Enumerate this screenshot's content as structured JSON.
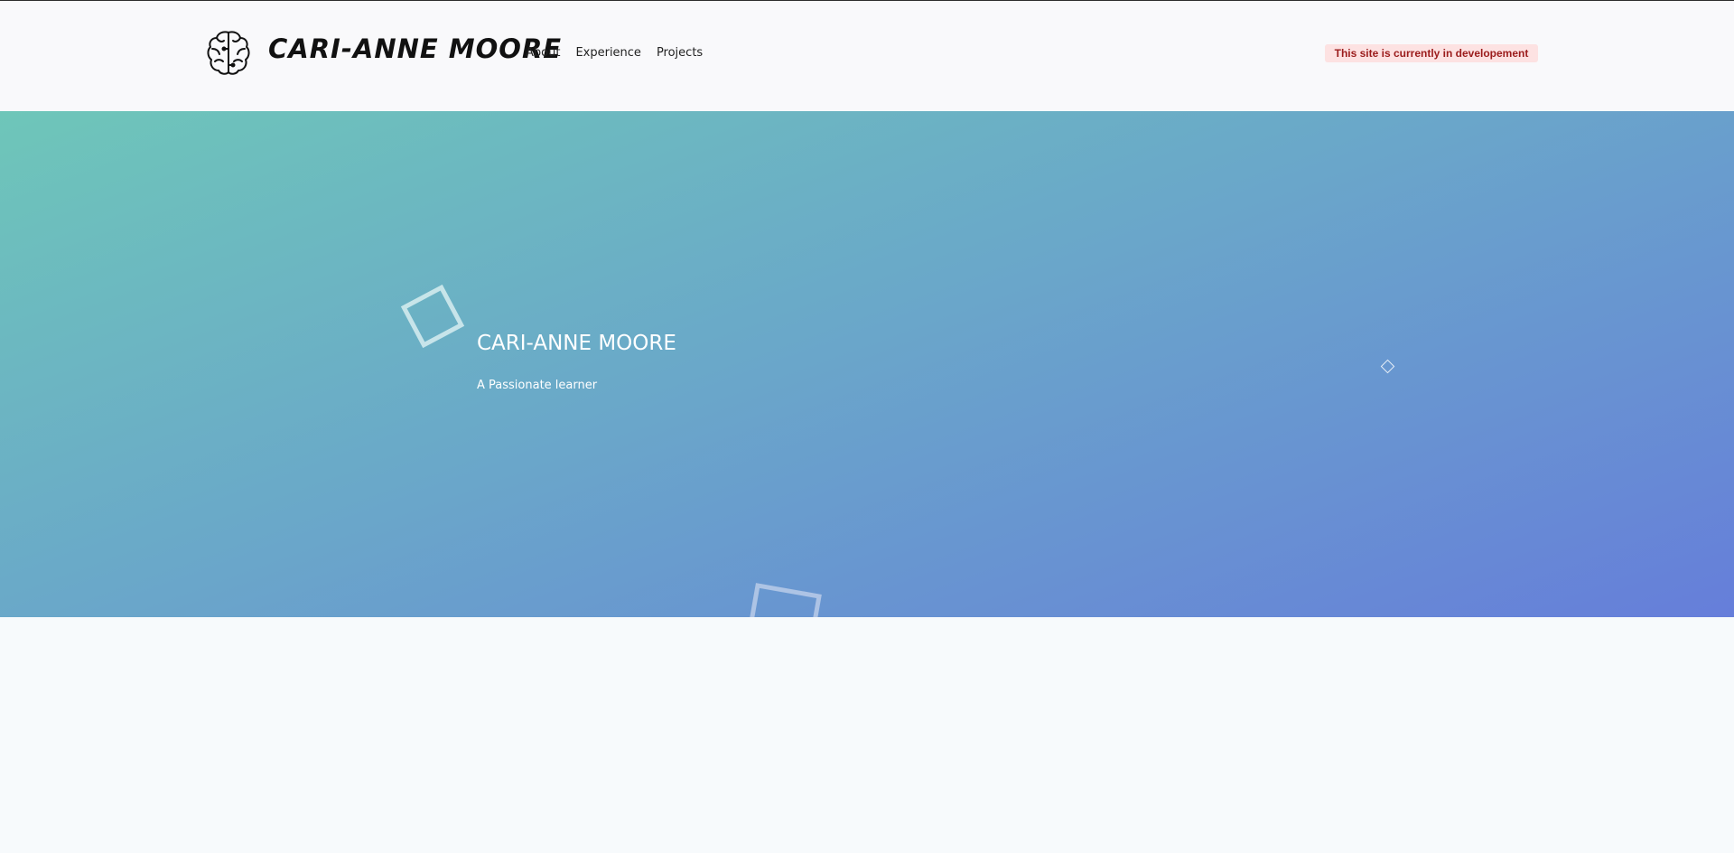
{
  "header": {
    "brand": "CARI-ANNE MOORE",
    "logo_icon": "brain-icon",
    "nav": [
      {
        "label": "About"
      },
      {
        "label": "Experience"
      },
      {
        "label": "Projects"
      }
    ],
    "notice": "This site is currently in developement"
  },
  "hero": {
    "title": "CARI-ANNE MOORE",
    "subtitle": "A Passionate learner",
    "gradient": [
      "#6ec6b9",
      "#6aa8c9",
      "#667eda"
    ]
  },
  "colors": {
    "notice_bg": "#fde2e2",
    "notice_text": "#9b1c1c",
    "page_bg": "#f7fafc"
  }
}
